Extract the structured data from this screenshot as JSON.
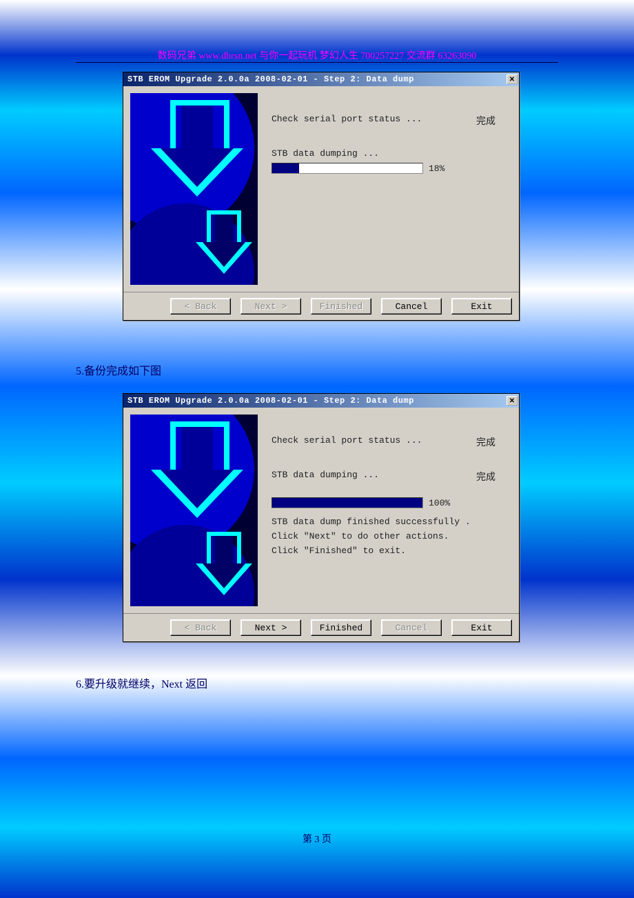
{
  "header": "数码兄弟 www.dbrsn.net 与你一起玩机  梦幻人生  700257227   交流群 63263090",
  "dialog1": {
    "title": "STB EROM Upgrade 2.0.0a 2008-02-01 - Step 2: Data dump",
    "check_label": "Check serial port status ...",
    "check_status": "完成",
    "dump_label": "STB data dumping ...",
    "progress_pct": "18%",
    "progress_fill": 18,
    "buttons": {
      "back": "< Back",
      "next": "Next >",
      "finished": "Finished",
      "cancel": "Cancel",
      "exit": "Exit"
    },
    "enabled": {
      "back": false,
      "next": false,
      "finished": false,
      "cancel": true,
      "exit": true
    }
  },
  "caption5": "5.备份完成如下图",
  "dialog2": {
    "title": "STB EROM Upgrade 2.0.0a 2008-02-01 - Step 2: Data dump",
    "check_label": "Check serial port status ...",
    "check_status": "完成",
    "dump_label": "STB data dumping ...",
    "dump_status": "完成",
    "progress_pct": "100%",
    "progress_fill": 100,
    "msg1": "STB data dump finished successfully .",
    "msg2": "Click \"Next\" to do other actions.",
    "msg3": "Click \"Finished\" to exit.",
    "buttons": {
      "back": "< Back",
      "next": "Next >",
      "finished": "Finished",
      "cancel": "Cancel",
      "exit": "Exit"
    },
    "enabled": {
      "back": false,
      "next": true,
      "finished": true,
      "cancel": false,
      "exit": true
    }
  },
  "caption6": "6.要升级就继续，Next 返回",
  "page_footer": "第 3 页"
}
